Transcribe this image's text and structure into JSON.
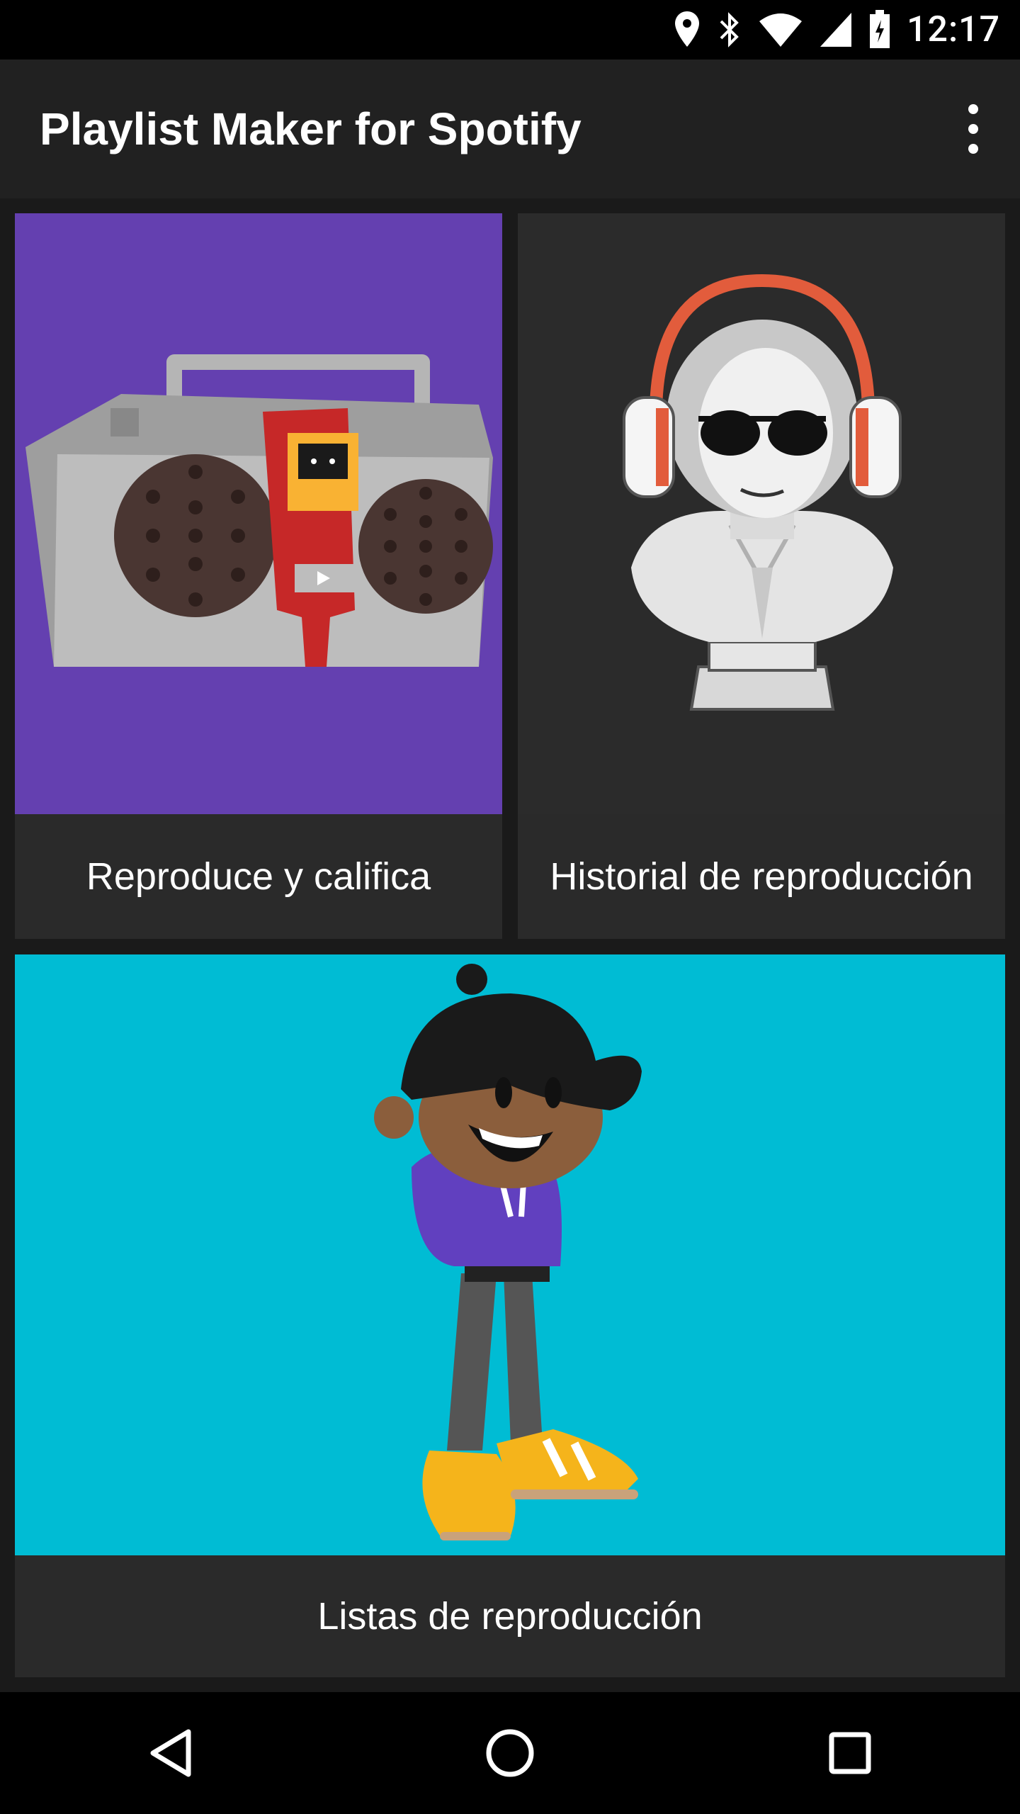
{
  "status_bar": {
    "time": "12:17",
    "icons": [
      "location-icon",
      "bluetooth-icon",
      "wifi-icon",
      "signal-icon",
      "battery-charging-icon"
    ]
  },
  "app_bar": {
    "title": "Playlist Maker for Spotify",
    "overflow_icon": "more-vert-icon"
  },
  "cards": [
    {
      "label": "Reproduce y califica",
      "image": "boombox-illustration",
      "bg": "#6440B0"
    },
    {
      "label": "Historial de reproducción",
      "image": "bust-with-headphones-illustration",
      "bg": "#2B2B2B"
    },
    {
      "label": "Listas de reproducción",
      "image": "boy-with-cap-illustration",
      "bg": "#00BCD4"
    }
  ],
  "nav_bar": {
    "icons": [
      "back-icon",
      "home-icon",
      "recents-icon"
    ]
  },
  "colors": {
    "status_bar_bg": "#000000",
    "app_bar_bg": "#212121",
    "card_caption_bg": "#2A2A2A",
    "page_bg": "#1A1A1A"
  }
}
